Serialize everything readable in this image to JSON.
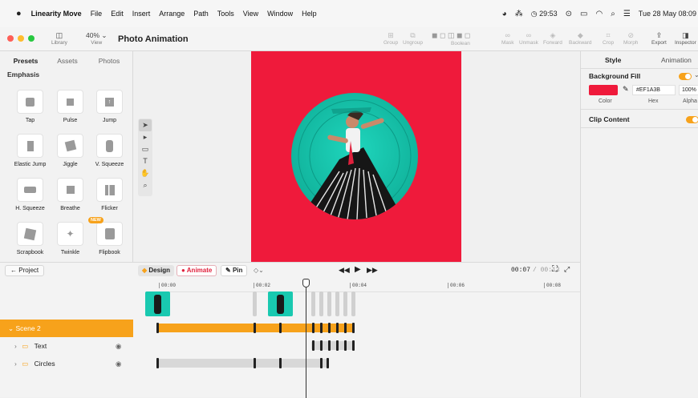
{
  "menubar": {
    "app_name": "Linearity Move",
    "items": [
      "File",
      "Edit",
      "Insert",
      "Arrange",
      "Path",
      "Tools",
      "View",
      "Window",
      "Help"
    ],
    "timer": "29:53",
    "datetime": "Tue 28 May 08:09"
  },
  "toolbar": {
    "library_label": "Library",
    "zoom_value": "40%",
    "view_label": "View",
    "doc_title": "Photo Animation",
    "group_label": "Group",
    "ungroup_label": "Ungroup",
    "boolean_label": "Boolean",
    "mask_label": "Mask",
    "unmask_label": "Unmask",
    "forward_label": "Forward",
    "backward_label": "Backward",
    "crop_label": "Crop",
    "morph_label": "Morph",
    "export_label": "Export",
    "inspector_label": "Inspector"
  },
  "left_panel": {
    "tabs": [
      "Presets",
      "Assets",
      "Photos"
    ],
    "section": "Emphasis",
    "presets": [
      "Tap",
      "Pulse",
      "Jump",
      "Elastic Jump",
      "Jiggle",
      "V. Squeeze",
      "H. Squeeze",
      "Breathe",
      "Flicker",
      "Scrapbook",
      "Twinkle",
      "Flipbook"
    ],
    "new_badge": "NEW"
  },
  "timeline": {
    "back_label": "Project",
    "design_label": "Design",
    "animate_label": "Animate",
    "pin_label": "Pin",
    "time_current": "00:07",
    "time_total": "/ 00:13",
    "ruler": [
      "00:00",
      "00:02",
      "00:04",
      "00:06",
      "00:08"
    ],
    "layers": [
      {
        "name": "Scene 2",
        "selected": true
      },
      {
        "name": "Text",
        "selected": false
      },
      {
        "name": "Circles",
        "selected": false
      }
    ]
  },
  "inspector": {
    "tabs": [
      "Style",
      "Animation"
    ],
    "background_fill_label": "Background Fill",
    "hex_value": "#EF1A3B",
    "alpha_value": "100%",
    "color_label": "Color",
    "hex_label": "Hex",
    "alpha_label": "Alpha",
    "clip_content_label": "Clip Content"
  },
  "colors": {
    "artboard": "#EF1A3B",
    "accent": "#F7A21B",
    "teal": "#19C9B0"
  }
}
